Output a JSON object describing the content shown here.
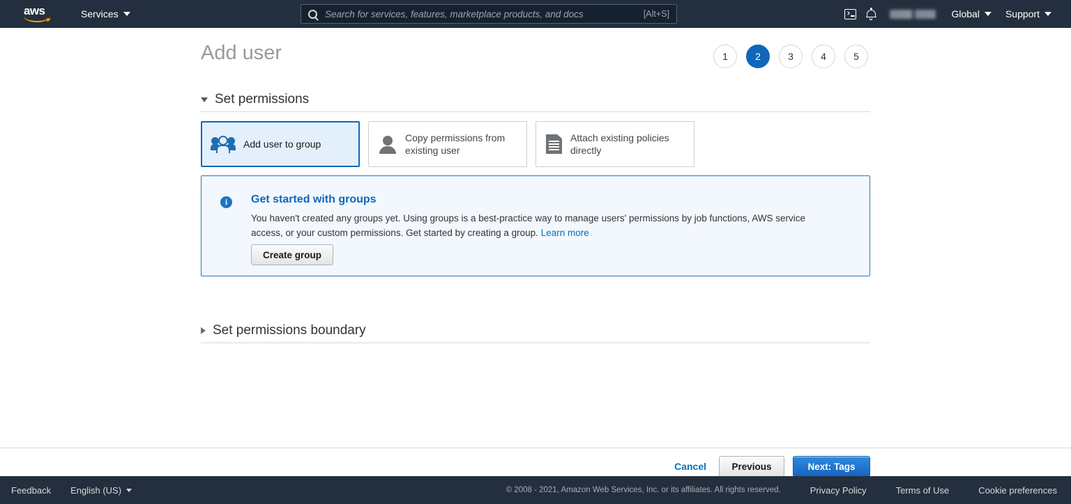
{
  "topnav": {
    "logo_alt": "aws",
    "services_label": "Services",
    "search": {
      "placeholder": "Search for services, features, marketplace products, and docs",
      "value": "",
      "shortcut": "[Alt+S]"
    },
    "account_label": "",
    "region_label": "Global",
    "support_label": "Support"
  },
  "page": {
    "title": "Add user",
    "steps": [
      {
        "label": "1",
        "active": false
      },
      {
        "label": "2",
        "active": true
      },
      {
        "label": "3",
        "active": false
      },
      {
        "label": "4",
        "active": false
      },
      {
        "label": "5",
        "active": false
      }
    ]
  },
  "permissions_section": {
    "title": "Set permissions",
    "expanded": true,
    "options": [
      {
        "label": "Add user to group",
        "icon": "users-group-icon",
        "selected": true
      },
      {
        "label": "Copy permissions from existing user",
        "icon": "user-icon",
        "selected": false
      },
      {
        "label": "Attach existing policies directly",
        "icon": "document-icon",
        "selected": false
      }
    ]
  },
  "alert": {
    "icon": "info-icon",
    "icon_glyph": "i",
    "title": "Get started with groups",
    "body": "You haven't created any groups yet. Using groups is a best-practice way to manage users' permissions by job functions, AWS service access, or your custom permissions. Get started by creating a group.",
    "link_label": "Learn more",
    "button_label": "Create group"
  },
  "boundary_section": {
    "title": "Set permissions boundary",
    "expanded": false
  },
  "actions": {
    "cancel_label": "Cancel",
    "previous_label": "Previous",
    "next_label": "Next: Tags"
  },
  "footer": {
    "feedback_label": "Feedback",
    "language_label": "English (US)",
    "copyright": "© 2008 - 2021, Amazon Web Services, Inc. or its affiliates. All rights reserved.",
    "privacy_label": "Privacy Policy",
    "terms_label": "Terms of Use",
    "cookies_label": "Cookie preferences"
  },
  "colors": {
    "nav_bg": "#232f3e",
    "accent_blue": "#1066bb",
    "link_blue": "#0073bb",
    "selected_card_bg": "#e3f0fb",
    "alert_bg": "#f2f8fd",
    "aws_orange": "#ff9900"
  }
}
